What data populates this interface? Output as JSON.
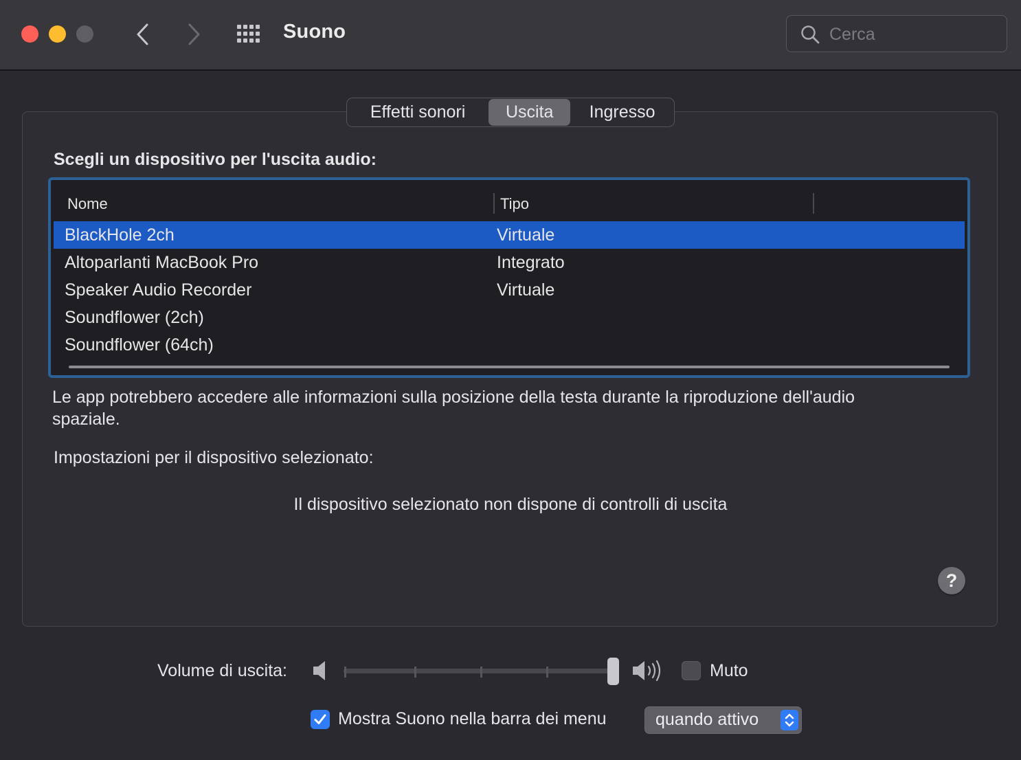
{
  "window": {
    "title": "Suono",
    "search_placeholder": "Cerca"
  },
  "tabs": [
    {
      "label": "Effetti sonori",
      "selected": false
    },
    {
      "label": "Uscita",
      "selected": true
    },
    {
      "label": "Ingresso",
      "selected": false
    }
  ],
  "output": {
    "heading": "Scegli un dispositivo per l'uscita audio:",
    "columns": [
      "Nome",
      "Tipo"
    ],
    "devices": [
      {
        "name": "BlackHole 2ch",
        "type": "Virtuale",
        "selected": true
      },
      {
        "name": "Altoparlanti MacBook Pro",
        "type": "Integrato",
        "selected": false
      },
      {
        "name": "Speaker Audio Recorder",
        "type": "Virtuale",
        "selected": false
      },
      {
        "name": "Soundflower (2ch)",
        "type": "",
        "selected": false
      },
      {
        "name": "Soundflower (64ch)",
        "type": "",
        "selected": false
      }
    ],
    "info": "Le app potrebbero accedere alle informazioni sulla posizione della testa durante la riproduzione dell'audio spaziale.",
    "settings_label": "Impostazioni per il dispositivo selezionato:",
    "no_controls": "Il dispositivo selezionato non dispone di controlli di uscita",
    "help": "?"
  },
  "volume": {
    "label": "Volume di uscita:",
    "level": 1.0,
    "mute_label": "Muto",
    "muted": false
  },
  "menubar": {
    "label": "Mostra Suono nella barra dei menu",
    "checked": true,
    "mode": "quando attivo"
  },
  "colors": {
    "accent": "#2f7cf6",
    "selection": "#1c5ac4",
    "focus_ring": "#2d6195"
  }
}
